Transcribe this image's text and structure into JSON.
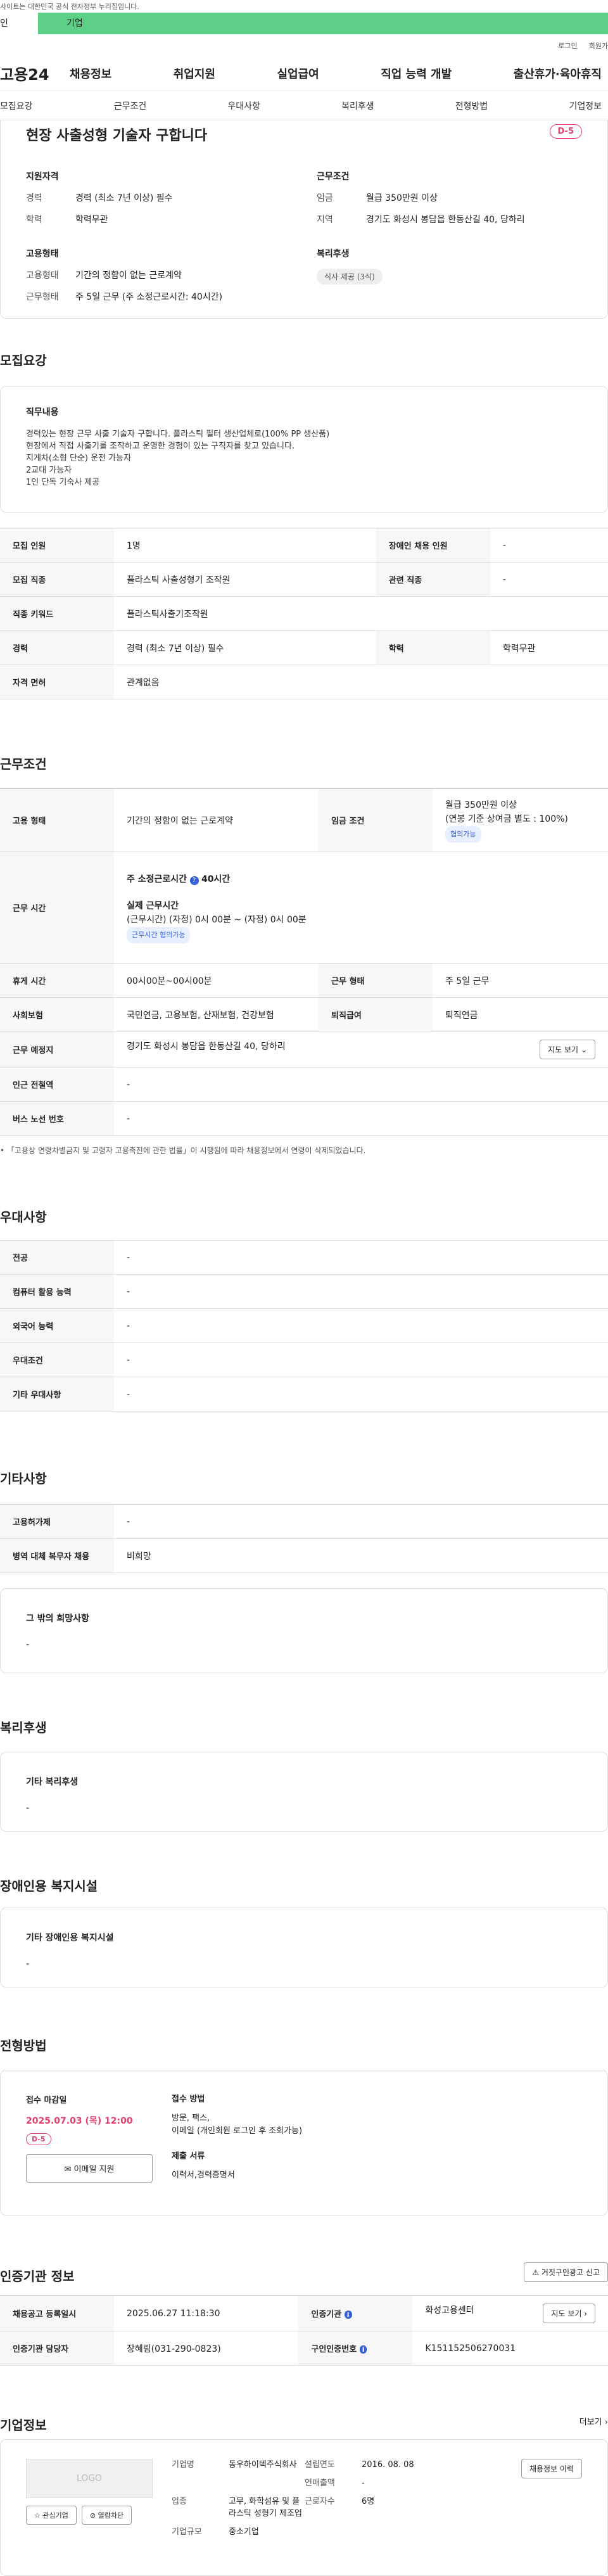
{
  "top": {
    "notice": "사이트는 대한민국 공식 전자정부 누리집입니다.",
    "left": "인",
    "tab": "기업",
    "login": "로그인",
    "join": "회원가"
  },
  "gnb": {
    "logo": "고용24",
    "menu": [
      "채용정보",
      "취업지원",
      "실업급여",
      "직업 능력 개발",
      "출산휴가·육아휴직"
    ]
  },
  "subnav": [
    "모집요강",
    "근무조건",
    "우대사항",
    "복리후생",
    "전형방법",
    "기업정보"
  ],
  "hero": {
    "title": "현장 사출성형 기술자 구합니다",
    "dday": "D-5",
    "s1": "지원자격",
    "s2": "근무조건",
    "s3": "고용형태",
    "s4": "복리후생",
    "career_k": "경력",
    "career_v": "경력 (최소 7년 이상) 필수",
    "edu_k": "학력",
    "edu_v": "학력무관",
    "wage_k": "임금",
    "wage_v": "월급 350만원 이상",
    "area_k": "지역",
    "area_v": "경기도 화성시 봉담읍 한동산길 40, 당하리",
    "emp_k": "고용형태",
    "emp_v": "기간의 정함이 없는 근로계약",
    "work_k": "근무형태",
    "work_v": "주 5일 근무 (주 소정근로시간: 40시간)",
    "welfare": "식사 제공 (3식)"
  },
  "req": {
    "title": "모집요강",
    "job_title": "직무내용",
    "job_lines": [
      "경력있는 현장 근무 사출 기술자  구합니다. 플라스틱 필터 생산업체로(100% PP 생산품)",
      "현장에서 직접 사출기를 조작하고 운영한 경험이 있는 구직자를 찾고 있습니다.",
      "지게차(소형 단순) 운전 가능자",
      "2교대 가능자",
      "1인 단독 기숙사 제공"
    ],
    "rows": [
      [
        "모집 인원",
        "1명",
        "장애인 채용 인원",
        "-"
      ],
      [
        "모집 직종",
        "플라스틱 사출성형기 조작원",
        "관련 직종",
        "-"
      ],
      [
        "직종 키워드",
        "플라스틱사출기조작원",
        "",
        ""
      ],
      [
        "경력",
        "경력 (최소 7년 이상) 필수",
        "학력",
        "학력무관"
      ],
      [
        "자격 면허",
        "관계없음",
        "",
        ""
      ]
    ]
  },
  "cond": {
    "title": "근무조건",
    "emp_k": "고용 형태",
    "emp_v": "기간의 정함이 없는 근로계약",
    "wage_k": "임금 조건",
    "wage_v1": "월급 350만원 이상",
    "wage_v2": "(연봉 기준 상여금 별도 : 100%)",
    "wage_tag": "협의가능",
    "hours_k": "근무 시간",
    "hours_v1": "주 소정근로시간",
    "hours_v1b": "40시간",
    "hours_v2": "실제 근무시간",
    "hours_v3": "(근무시간) (자정) 0시 00분 ~ (자정) 0시 00분",
    "hours_tag": "근무시간 협의가능",
    "rows": [
      [
        "휴게 시간",
        "00시00분~00시00분",
        "근무 형태",
        "주 5일 근무"
      ],
      [
        "사회보험",
        "국민연금, 고용보험, 산재보험, 건강보험",
        "퇴직급여",
        "퇴직연금"
      ]
    ],
    "place_k": "근무 예정지",
    "place_v": "경기도 화성시 봉담읍 한동산길 40, 당하리",
    "map": "지도 보기",
    "subway_k": "인근 전철역",
    "subway_v": "-",
    "bus_k": "버스 노선 번호",
    "bus_v": "-",
    "note": "「고용상 연령차별금지 및 고령자 고용촉진에 관한 법률」이 시행됨에 따라 채용정보에서 연령이 삭제되었습니다."
  },
  "pref": {
    "title": "우대사항",
    "rows": [
      [
        "전공",
        "-"
      ],
      [
        "컴퓨터 활용 능력",
        "-"
      ],
      [
        "외국어 능력",
        "-"
      ],
      [
        "우대조건",
        "-"
      ],
      [
        "기타 우대사항",
        "-"
      ]
    ]
  },
  "etc": {
    "title": "기타사항",
    "rows": [
      [
        "고용허가제",
        "-"
      ],
      [
        "병역 대체 복무자 채용",
        "비희망"
      ]
    ],
    "box_title": "그 밖의 희망사항",
    "box_val": "-"
  },
  "welfare": {
    "title": "복리후생",
    "box_title": "기타 복리후생",
    "box_val": "-"
  },
  "disab": {
    "title": "장애인용 복지시설",
    "box_title": "기타 장애인용 복지시설",
    "box_val": "-"
  },
  "select": {
    "title": "전형방법",
    "deadline_k": "접수 마감일",
    "deadline_v": "2025.07.03 (목) 12:00",
    "dday": "D-5",
    "email_btn": "이메일 지원",
    "method_k": "접수 방법",
    "method_v1": "방문, 팩스,",
    "method_v2": "이메일 (개인회원 로그인 후 조회가능)",
    "docs_k": "제출 서류",
    "docs_v": "이력서,경력증명서"
  },
  "cert": {
    "title": "인증기관 정보",
    "report": "거짓구인광고 신고",
    "rows": [
      [
        "채용공고 등록일시",
        "2025.06.27 11:18:30",
        "인증기관",
        "화성고용센터"
      ],
      [
        "인증기관 담당자",
        "장혜림(031-290-0823)",
        "구인인증번호",
        "K151152506270031"
      ]
    ],
    "map": "지도 보기"
  },
  "company": {
    "title": "기업정보",
    "more": "더보기",
    "logo": "LOGO",
    "fav": "관심기업",
    "block": "열람차단",
    "name_k": "기업명",
    "name_v": "동우하이텍주식회사",
    "ind_k": "업종",
    "ind_v": "고무, 화학섬유 및 플라스틱 성형기 제조업",
    "size_k": "기업규모",
    "size_v": "중소기업",
    "est_k": "설립연도",
    "est_v": "2016. 08. 08",
    "sales_k": "연매출액",
    "sales_v": "-",
    "emp_k": "근로자수",
    "emp_v": "6명",
    "btn": "채용정보 이력"
  }
}
